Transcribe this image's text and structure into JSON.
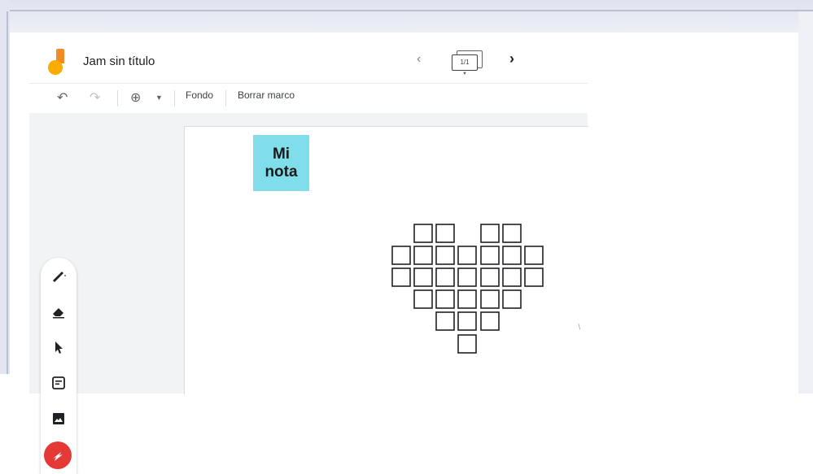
{
  "app": {
    "title": "Jam sin título",
    "frame_indicator": "1/1"
  },
  "toolbar": {
    "fondo_label": "Fondo",
    "borrar_marco_label": "Borrar marco"
  },
  "canvas": {
    "sticky_note_text": "Mi\nnota",
    "sticky_color": "#80deea"
  },
  "tools": [
    {
      "icon": "pen-icon"
    },
    {
      "icon": "eraser-icon"
    },
    {
      "icon": "select-icon"
    },
    {
      "icon": "sticky-note-icon"
    },
    {
      "icon": "image-icon"
    },
    {
      "icon": "laser-icon"
    }
  ],
  "colors": {
    "laser_button": "#e53935",
    "logo_orange": "#f28b23",
    "logo_yellow": "#f9ab00"
  }
}
